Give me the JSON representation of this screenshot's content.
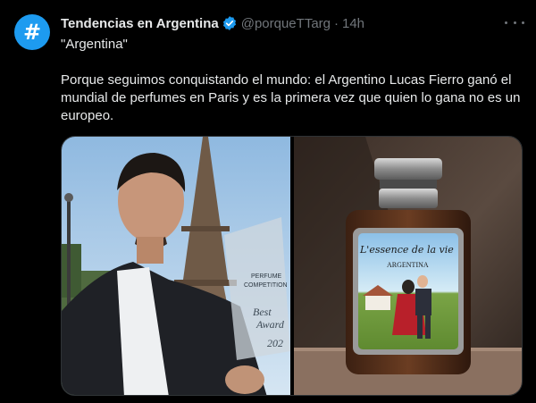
{
  "account": {
    "display_name": "Tendencias en Argentina",
    "handle": "@porqueTTarg",
    "separator": "·",
    "time": "14h",
    "avatar_glyph": "#",
    "avatar_color": "#1d9bf0",
    "verified": true
  },
  "tweet": {
    "quote": "\"Argentina\"",
    "text": "Porque seguimos conquistando el mundo: el Argentino Lucas Fierro ganó el mundial de perfumes en Paris y es la primera vez que quien lo gana no es un europeo."
  },
  "media": {
    "left_photo": {
      "trophy_text_1": "PERFUME",
      "trophy_text_2": "COMPETITION",
      "trophy_text_3": "Best",
      "trophy_text_4": "Award",
      "trophy_text_5": "202"
    },
    "right_photo": {
      "label_script": "L'essence de la vie",
      "label_country": "ARGENTINA"
    }
  },
  "colors": {
    "background": "#000000",
    "text_primary": "#e7e9ea",
    "text_secondary": "#71767b",
    "accent": "#1d9bf0"
  },
  "icons": [
    "verified-badge-icon",
    "more-options-icon",
    "hashtag-avatar-icon"
  ]
}
